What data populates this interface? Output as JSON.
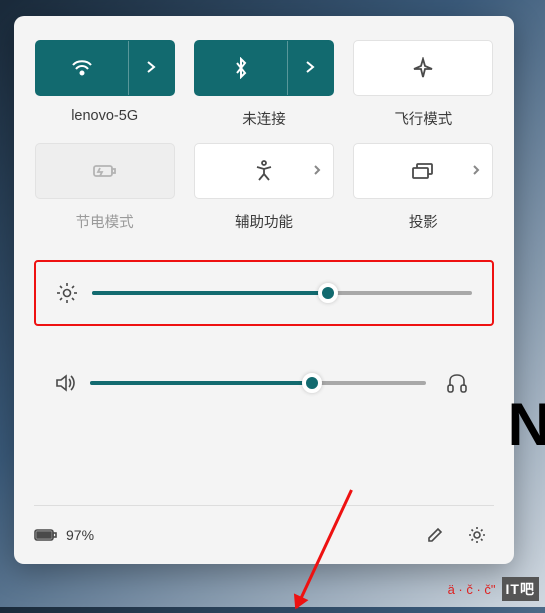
{
  "tiles": {
    "wifi": {
      "label": "lenovo-5G",
      "active": true,
      "split": true,
      "icon": "wifi"
    },
    "bluetooth": {
      "label": "未连接",
      "active": true,
      "split": true,
      "icon": "bluetooth"
    },
    "airplane": {
      "label": "飞行模式",
      "active": false,
      "split": false,
      "icon": "airplane"
    },
    "battery": {
      "label": "节电模式",
      "active": false,
      "split": false,
      "icon": "battery-saver",
      "disabled": true
    },
    "access": {
      "label": "辅助功能",
      "active": false,
      "split": false,
      "icon": "accessibility",
      "arrow": true
    },
    "project": {
      "label": "投影",
      "active": false,
      "split": false,
      "icon": "project",
      "arrow": true
    }
  },
  "sliders": {
    "brightness": {
      "percent": 62
    },
    "volume": {
      "percent": 66
    }
  },
  "battery": {
    "text": "97%"
  },
  "watermark": {
    "accents": "ä · č · č\"",
    "logo": "IT吧"
  },
  "colors": {
    "accent": "#126a6f",
    "highlight": "#e11"
  }
}
